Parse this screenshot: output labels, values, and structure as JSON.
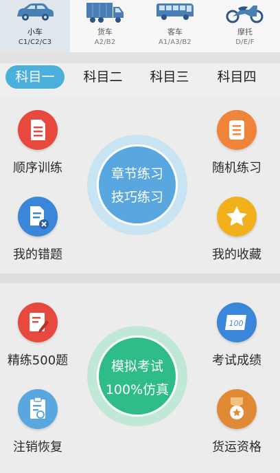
{
  "vehicles": [
    {
      "name": "小车",
      "codes": "C1/C2/C3",
      "icon": "car-icon",
      "active": true
    },
    {
      "name": "货车",
      "codes": "A2/B2",
      "icon": "truck-icon",
      "active": false
    },
    {
      "name": "客车",
      "codes": "A1/A3/B2",
      "icon": "bus-icon",
      "active": false
    },
    {
      "name": "摩托",
      "codes": "D/E/F",
      "icon": "motorcycle-icon",
      "active": false
    }
  ],
  "subjects": [
    "科目一",
    "科目二",
    "科目三",
    "科目四"
  ],
  "practice": {
    "sequential": "顺序训练",
    "random": "随机练习",
    "mistakes": "我的错题",
    "favorites": "我的收藏",
    "center_line1": "章节练习",
    "center_line2": "技巧练习"
  },
  "exam": {
    "refined": "精练500题",
    "scores": "考试成绩",
    "restore": "注销恢复",
    "freight": "货运资格",
    "center_line1": "模拟考试",
    "center_line2": "100%仿真"
  },
  "colors": {
    "accent_blue": "#4bb0dc",
    "red": "#e8493f",
    "orange": "#f0843a",
    "blue": "#3a86d8",
    "yellow": "#f3b01d",
    "green": "#2fbd87",
    "sky": "#5aa7df"
  }
}
